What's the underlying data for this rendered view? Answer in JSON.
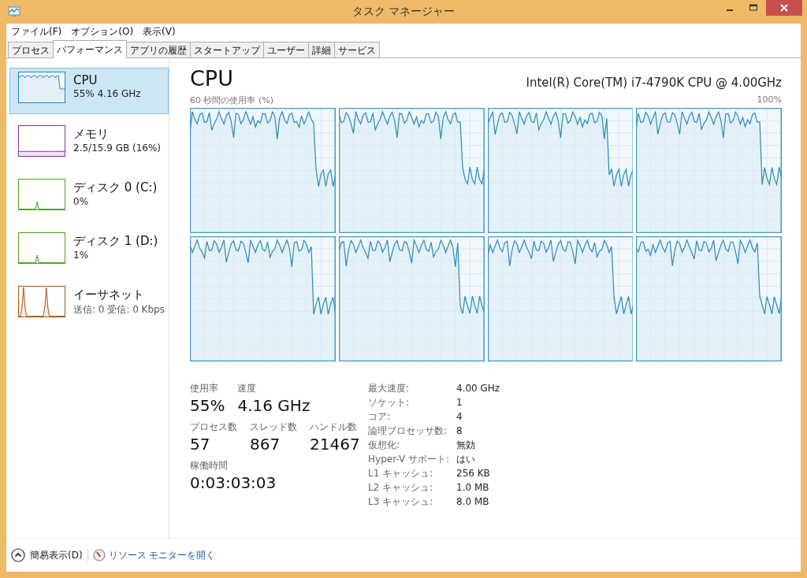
{
  "window": {
    "title": "タスク マネージャー"
  },
  "menu": [
    "ファイル(F)",
    "オプション(O)",
    "表示(V)"
  ],
  "tabs": [
    {
      "label": "プロセス",
      "selected": false
    },
    {
      "label": "パフォーマンス",
      "selected": true
    },
    {
      "label": "アプリの履歴",
      "selected": false
    },
    {
      "label": "スタートアップ",
      "selected": false
    },
    {
      "label": "ユーザー",
      "selected": false
    },
    {
      "label": "詳細",
      "selected": false
    },
    {
      "label": "サービス",
      "selected": false
    }
  ],
  "sidebar": {
    "items": [
      {
        "kind": "cpu",
        "name": "CPU",
        "detail": "55% 4.16 GHz",
        "color": "#1b86be",
        "selected": true
      },
      {
        "kind": "memory",
        "name": "メモリ",
        "detail": "2.5/15.9 GB (16%)",
        "color": "#8b2aa4",
        "selected": false
      },
      {
        "kind": "disk",
        "name": "ディスク 0 (C:)",
        "detail": "0%",
        "color": "#4ea112",
        "selected": false
      },
      {
        "kind": "disk",
        "name": "ディスク 1 (D:)",
        "detail": "1%",
        "color": "#4ea112",
        "selected": false
      },
      {
        "kind": "network",
        "name": "イーサネット",
        "detail": "送信: 0 受信: 0 Kbps",
        "color": "#a7550f",
        "selected": false
      }
    ]
  },
  "main": {
    "title": "CPU",
    "processor": "Intel(R) Core(TM) i7-4790K CPU @ 4.00GHz",
    "graph_caption": "60 秒間の使用率 (%)",
    "graph_max": "100%",
    "stats": [
      [
        {
          "label": "使用率",
          "value": "55%"
        },
        {
          "label": "速度",
          "value": "4.16 GHz"
        }
      ],
      [
        {
          "label": "プロセス数",
          "value": "57"
        },
        {
          "label": "スレッド数",
          "value": "867"
        },
        {
          "label": "ハンドル数",
          "value": "21467"
        }
      ],
      [
        {
          "label": "稼働時間",
          "value": "0:03:03:03"
        }
      ]
    ],
    "details": [
      {
        "label": "最大速度:",
        "value": "4.00 GHz"
      },
      {
        "label": "ソケット:",
        "value": "1"
      },
      {
        "label": "コア:",
        "value": "4"
      },
      {
        "label": "論理プロセッサ数:",
        "value": "8"
      },
      {
        "label": "仮想化:",
        "value": "無効"
      },
      {
        "label": "Hyper-V サポート:",
        "value": "はい"
      },
      {
        "label": "L1 キャッシュ:",
        "value": "256 KB"
      },
      {
        "label": "L2 キャッシュ:",
        "value": "1.0 MB"
      },
      {
        "label": "L3 キャッシュ:",
        "value": "8.0 MB"
      }
    ]
  },
  "footer": {
    "fewer_details": "簡易表示(D)",
    "resource_monitor": "リソース モニターを開く"
  }
}
